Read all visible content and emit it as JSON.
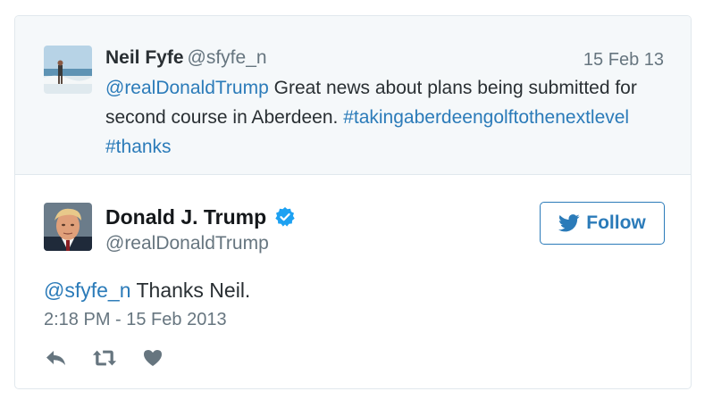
{
  "quoted_tweet": {
    "author_name": "Neil Fyfe",
    "author_handle": "@sfyfe_n",
    "date": "15 Feb 13",
    "mention": "@realDonaldTrump",
    "text_body": " Great news about plans being submitted for second course in Aberdeen. ",
    "hashtag_1": "#takingaberdeengolftothenextlevel",
    "hashtag_2": "#thanks"
  },
  "main_tweet": {
    "author_name": "Donald J. Trump",
    "author_handle": "@realDonaldTrump",
    "follow_label": "Follow",
    "mention": "@sfyfe_n",
    "text_body": " Thanks Neil.",
    "timestamp": "2:18 PM - 15 Feb 2013"
  },
  "icons": {
    "verified": "verified-badge-icon",
    "follow": "twitter-bird-icon",
    "reply": "reply-icon",
    "retweet": "retweet-icon",
    "like": "heart-icon"
  },
  "colors": {
    "link": "#2b7bb9",
    "muted": "#66757f",
    "text": "#292f33",
    "quoted_bg": "#f5f8fa",
    "verified": "#1da1f2"
  }
}
